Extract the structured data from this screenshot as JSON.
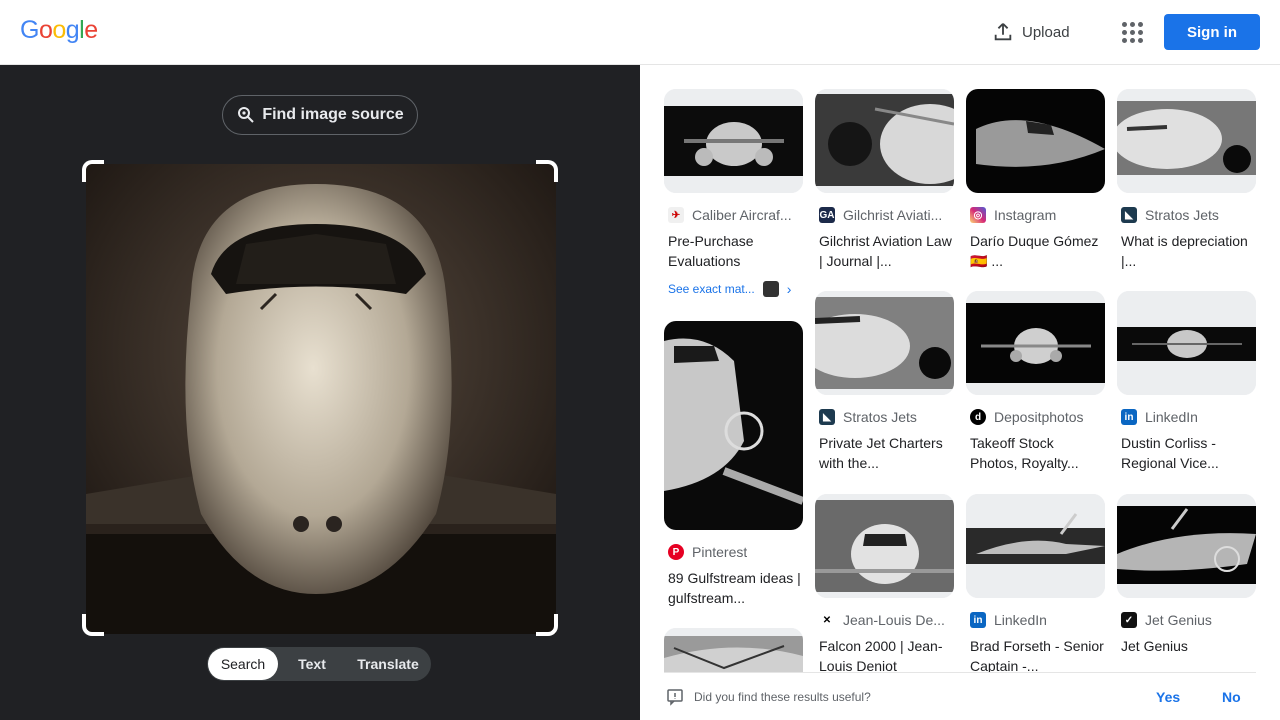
{
  "header": {
    "logo": {
      "letters": [
        "G",
        "o",
        "o",
        "g",
        "l",
        "e"
      ],
      "colors": [
        "#4285F4",
        "#EA4335",
        "#FBBC05",
        "#4285F4",
        "#34A853",
        "#EA4335"
      ]
    },
    "upload_label": "Upload",
    "apps_icon": "apps-grid-icon",
    "signin_label": "Sign in"
  },
  "left_panel": {
    "find_source_label": "Find image source",
    "modes": [
      {
        "label": "Search",
        "active": true
      },
      {
        "label": "Text",
        "active": false
      },
      {
        "label": "Translate",
        "active": false
      }
    ]
  },
  "results": {
    "see_exact_label": "See exact mat...",
    "cards": [
      {
        "source": "Caliber Aircraf...",
        "title": "Pre-Purchase Evaluations",
        "favicon_color": "#ffffff"
      },
      {
        "source": "Gilchrist Aviati...",
        "title": "Gilchrist Aviation Law | Journal |...",
        "favicon_color": "#1c2a4a"
      },
      {
        "source": "Instagram",
        "title": "Darío Duque Gómez 🇪🇸 ...",
        "favicon_color": "#d6249f"
      },
      {
        "source": "Stratos Jets",
        "title": "What is depreciation |...",
        "favicon_color": "#1d3a4f"
      },
      {
        "source": "Pinterest",
        "title": "89 Gulfstream ideas | gulfstream...",
        "favicon_color": "#e60023"
      },
      {
        "source": "Stratos Jets",
        "title": "Private Jet Charters with the...",
        "favicon_color": "#1d3a4f"
      },
      {
        "source": "Depositphotos",
        "title": "Takeoff Stock Photos, Royalty...",
        "favicon_color": "#000000"
      },
      {
        "source": "LinkedIn",
        "title": "Dustin Corliss - Regional Vice...",
        "favicon_color": "#0a66c2"
      },
      {
        "source": "Jean-Louis De...",
        "title": "Falcon 2000 | Jean-Louis Deniot",
        "favicon_color": "#ffffff"
      },
      {
        "source": "LinkedIn",
        "title": "Brad Forseth - Senior Captain -...",
        "favicon_color": "#0a66c2"
      },
      {
        "source": "Jet Genius",
        "title": "Jet Genius",
        "favicon_color": "#111111"
      }
    ]
  },
  "feedback": {
    "question": "Did you find these results useful?",
    "yes_label": "Yes",
    "no_label": "No"
  }
}
